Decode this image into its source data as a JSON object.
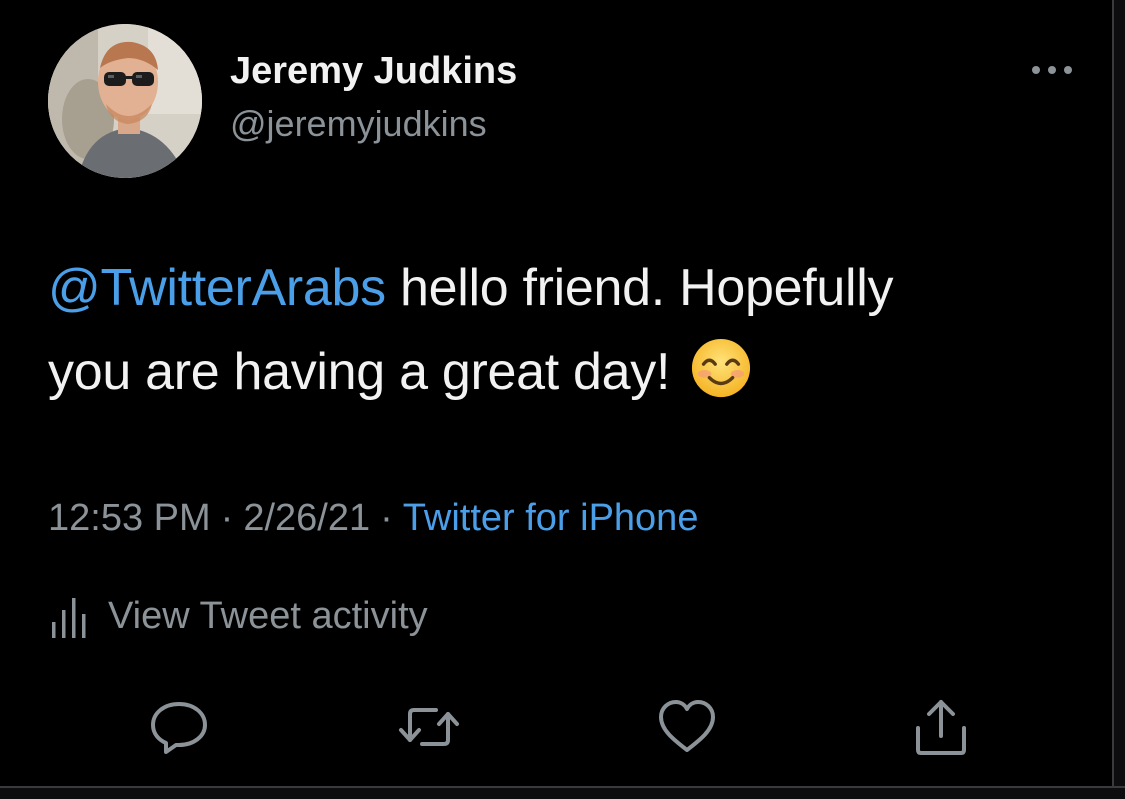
{
  "tweet": {
    "author": {
      "display_name": "Jeremy Judkins",
      "handle": "@jeremyjudkins"
    },
    "text": {
      "mention": "@TwitterArabs",
      "line1_rest": " hello friend. Hopefully",
      "line2": "you are having a great day!",
      "emoji": "smiling-face-with-smiling-eyes"
    },
    "meta": {
      "time": "12:53 PM",
      "separator": "·",
      "date": "2/26/21",
      "source": "Twitter for iPhone"
    },
    "activity_label": "View Tweet activity",
    "actions": [
      "reply-icon",
      "retweet-icon",
      "like-icon",
      "share-icon"
    ]
  },
  "colors": {
    "background": "#000000",
    "primary_text": "#f2f2f2",
    "secondary_text": "#8b9298",
    "link": "#4a9fe8"
  }
}
